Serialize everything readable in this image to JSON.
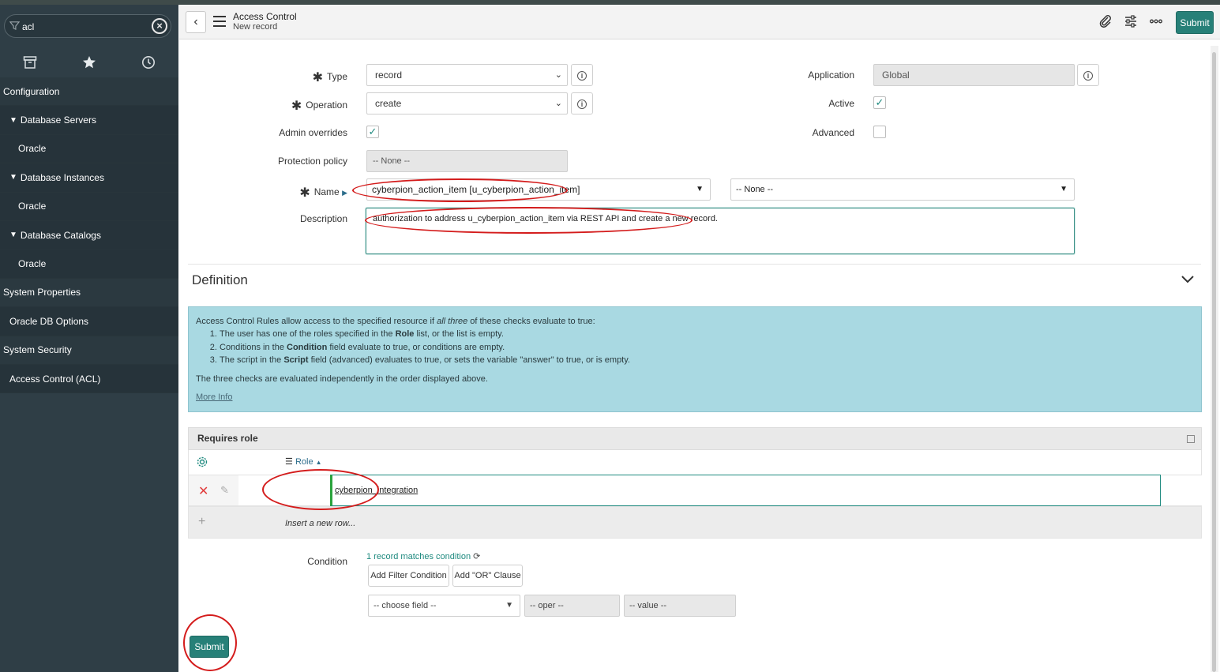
{
  "sidebar": {
    "search_value": "acl",
    "tabs": [
      "archive-icon",
      "star-icon",
      "clock-icon"
    ],
    "items": [
      {
        "label": "Configuration",
        "kind": "header"
      },
      {
        "label": "Database Servers",
        "kind": "group"
      },
      {
        "label": "Oracle",
        "kind": "leaf"
      },
      {
        "label": "Database Instances",
        "kind": "group"
      },
      {
        "label": "Oracle",
        "kind": "leaf"
      },
      {
        "label": "Database Catalogs",
        "kind": "group"
      },
      {
        "label": "Oracle",
        "kind": "leaf"
      },
      {
        "label": "System Properties",
        "kind": "header"
      },
      {
        "label": "Oracle DB Options",
        "kind": "sub"
      },
      {
        "label": "System Security",
        "kind": "header"
      },
      {
        "label": "Access Control (ACL)",
        "kind": "sub"
      }
    ]
  },
  "header": {
    "title": "Access Control",
    "subtitle": "New record",
    "submit_label": "Submit"
  },
  "form": {
    "type_label": "Type",
    "type_value": "record",
    "operation_label": "Operation",
    "operation_value": "create",
    "admin_overrides_label": "Admin overrides",
    "admin_overrides_checked": true,
    "protection_policy_label": "Protection policy",
    "protection_policy_value": "-- None --",
    "name_label": "Name",
    "name_value": "cyberpion_action_item [u_cyberpion_action_item]",
    "name_field_value": "-- None --",
    "description_label": "Description",
    "description_value": "authorization to address u_cyberpion_action_item via REST API and create a new record.",
    "application_label": "Application",
    "application_value": "Global",
    "active_label": "Active",
    "active_checked": true,
    "advanced_label": "Advanced",
    "advanced_checked": false
  },
  "definition": {
    "title": "Definition",
    "intro_a": "Access Control Rules allow access to the specified resource if ",
    "intro_em": "all three",
    "intro_b": " of these checks evaluate to true:",
    "rule1_a": "The user has one of the roles specified in the ",
    "rule1_b": "Role",
    "rule1_c": " list, or the list is empty.",
    "rule2_a": "Conditions in the ",
    "rule2_b": "Condition",
    "rule2_c": " field evaluate to true, or conditions are empty.",
    "rule3_a": "The script in the ",
    "rule3_b": "Script",
    "rule3_c": " field (advanced) evaluates to true, or sets the variable \"answer\" to true, or is empty.",
    "footer": "The three checks are evaluated independently in the order displayed above.",
    "more_info": "More Info"
  },
  "requires_role": {
    "title": "Requires role",
    "column": "Role",
    "role_value": "cyberpion_integration",
    "insert_row": "Insert a new row..."
  },
  "condition": {
    "label": "Condition",
    "match_text": "1 record matches condition",
    "add_filter": "Add Filter Condition",
    "add_or": "Add \"OR\" Clause",
    "field": "-- choose field --",
    "oper": "-- oper --",
    "value": "-- value --"
  },
  "footer": {
    "submit_label": "Submit"
  },
  "colors": {
    "accent": "#278078",
    "sidebar_bg": "#2f3e46",
    "info_bg": "#a9d9e2",
    "annotation": "#d41c1c"
  }
}
